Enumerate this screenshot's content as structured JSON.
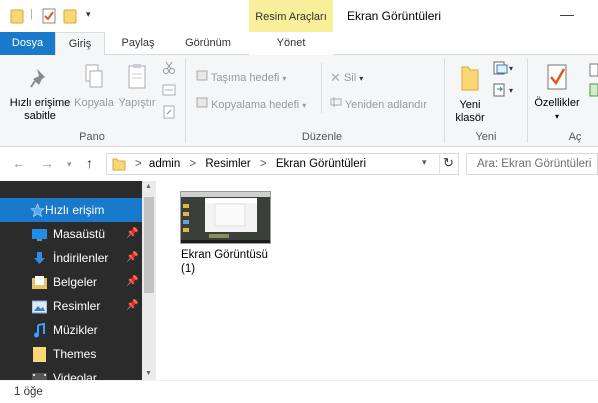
{
  "window": {
    "title": "Ekran Görüntüleri",
    "contextual_tab_group": "Resim Araçları",
    "minimize_glyph": "—"
  },
  "ribbon_tabs": {
    "file": "Dosya",
    "home": "Giriş",
    "share": "Paylaş",
    "view": "Görünüm",
    "manage": "Yönet"
  },
  "ribbon": {
    "clipboard": {
      "group_label": "Pano",
      "pin_quick_access": "Hızlı erişime\nsabitle",
      "copy": "Kopyala",
      "paste": "Yapıştır"
    },
    "organize": {
      "group_label": "Düzenle",
      "move_to": "Taşıma hedefi",
      "copy_to": "Kopyalama hedefi",
      "delete": "Sil",
      "rename": "Yeniden adlandır"
    },
    "new": {
      "group_label": "Yeni",
      "new_folder": "Yeni\nklasör"
    },
    "open": {
      "group_label": "Aç",
      "properties": "Özellikler"
    }
  },
  "address": {
    "crumbs": [
      "admin",
      "Resimler",
      "Ekran Görüntüleri"
    ],
    "separator": ">",
    "search_placeholder": "Ara: Ekran Görüntüleri"
  },
  "nav": {
    "items": [
      {
        "label": "Hızlı erişim",
        "icon": "star-icon",
        "pinned": false,
        "selected": true
      },
      {
        "label": "Masaüstü",
        "icon": "desktop-icon",
        "pinned": true
      },
      {
        "label": "İndirilenler",
        "icon": "download-icon",
        "pinned": true
      },
      {
        "label": "Belgeler",
        "icon": "documents-icon",
        "pinned": true
      },
      {
        "label": "Resimler",
        "icon": "pictures-icon",
        "pinned": true
      },
      {
        "label": "Müzikler",
        "icon": "music-icon",
        "pinned": false
      },
      {
        "label": "Themes",
        "icon": "folder-icon",
        "pinned": false
      },
      {
        "label": "Videolar",
        "icon": "videos-icon",
        "pinned": false
      }
    ]
  },
  "files": [
    {
      "name": "Ekran Görüntüsü (1)",
      "type": "image-thumbnail"
    }
  ],
  "status": {
    "item_count": "1 öğe"
  },
  "colors": {
    "accent": "#1979ca",
    "nav_bg": "#2b2b2b",
    "contextual_tab": "#f7ef9a",
    "folder_yellow": "#f8d775"
  }
}
